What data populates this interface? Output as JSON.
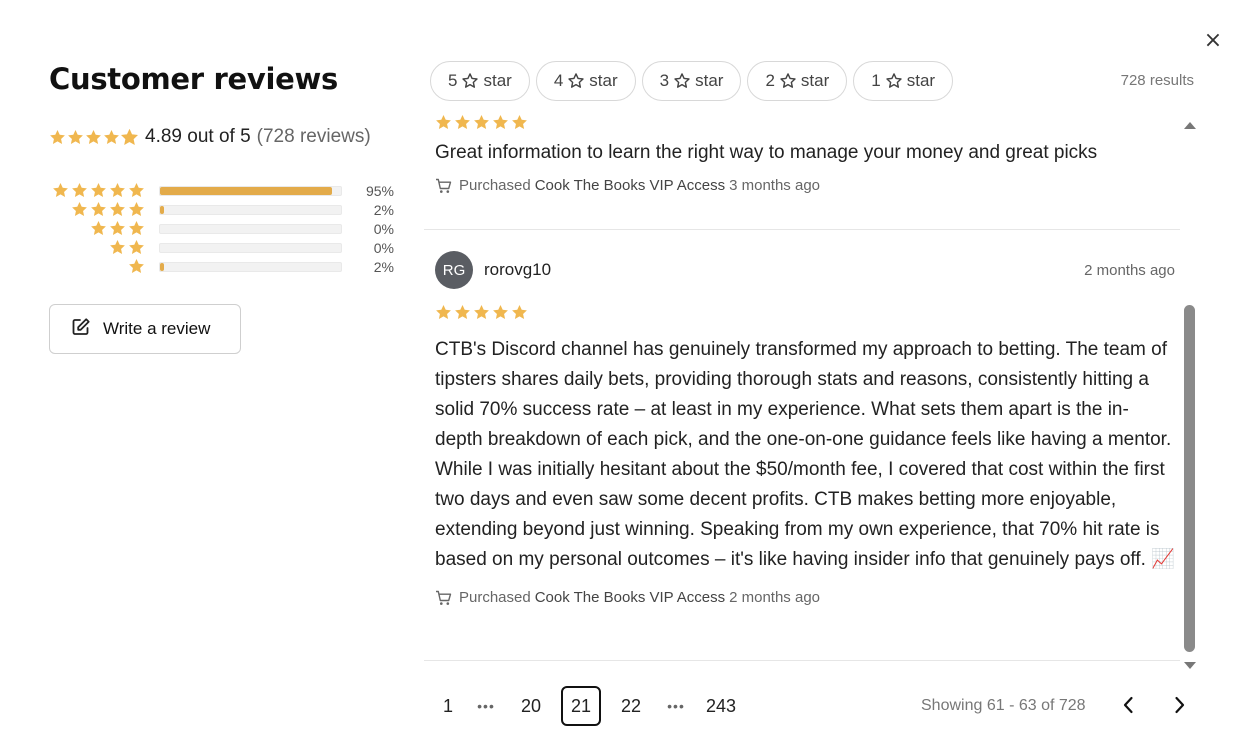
{
  "close_label": "×",
  "header": {
    "title": "Customer reviews",
    "rating_text": "4.89 out of 5",
    "reviews_count": "(728 reviews)",
    "rating_value": 4.89
  },
  "distribution": [
    {
      "stars": 5,
      "percent": 95,
      "label": "95%"
    },
    {
      "stars": 4,
      "percent": 2,
      "label": "2%"
    },
    {
      "stars": 3,
      "percent": 0,
      "label": "0%"
    },
    {
      "stars": 2,
      "percent": 0,
      "label": "0%"
    },
    {
      "stars": 1,
      "percent": 2,
      "label": "2%"
    }
  ],
  "write_review_label": "Write a review",
  "filters": {
    "chips": [
      {
        "num": "5",
        "word": "star"
      },
      {
        "num": "4",
        "word": "star"
      },
      {
        "num": "3",
        "word": "star"
      },
      {
        "num": "2",
        "word": "star"
      },
      {
        "num": "1",
        "word": "star"
      }
    ],
    "results": "728 results"
  },
  "reviews": [
    {
      "stars": 5,
      "text": "Great information to learn the right way to manage your money and great picks",
      "purchased_label": "Purchased",
      "product": "Cook The Books VIP Access",
      "ago": "3 months ago"
    },
    {
      "initials": "RG",
      "name": "rorovg10",
      "date": "2 months ago",
      "stars": 5,
      "text": "CTB's Discord channel has genuinely transformed my approach to betting. The team of tipsters shares daily bets, providing thorough stats and reasons, consistently hitting a solid 70% success rate – at least in my experience. What sets them apart is the in-depth breakdown of each pick, and the one-on-one guidance feels like having a mentor. While I was initially hesitant about the $50/month fee, I covered that cost within the first two days and even saw some decent profits. CTB makes betting more enjoyable, extending beyond just winning. Speaking from my own experience, that 70% hit rate is based on my personal outcomes – it's like having insider info that genuinely pays off. 📈",
      "purchased_label": "Purchased",
      "product": "Cook The Books VIP Access",
      "ago": "2 months ago"
    }
  ],
  "pagination": {
    "pages": [
      "1",
      "•••",
      "20",
      "21",
      "22",
      "•••",
      "243"
    ],
    "current": "21",
    "showing": "Showing 61 - 63 of 728"
  },
  "colors": {
    "star": "#f0b74f",
    "bar_fill": "#e3ab4a",
    "avatar_bg": "#5a5d63"
  },
  "icons": {
    "close": "close-icon",
    "write": "edit-icon",
    "cart": "cart-icon",
    "prev": "chevron-left-icon",
    "next": "chevron-right-icon"
  }
}
